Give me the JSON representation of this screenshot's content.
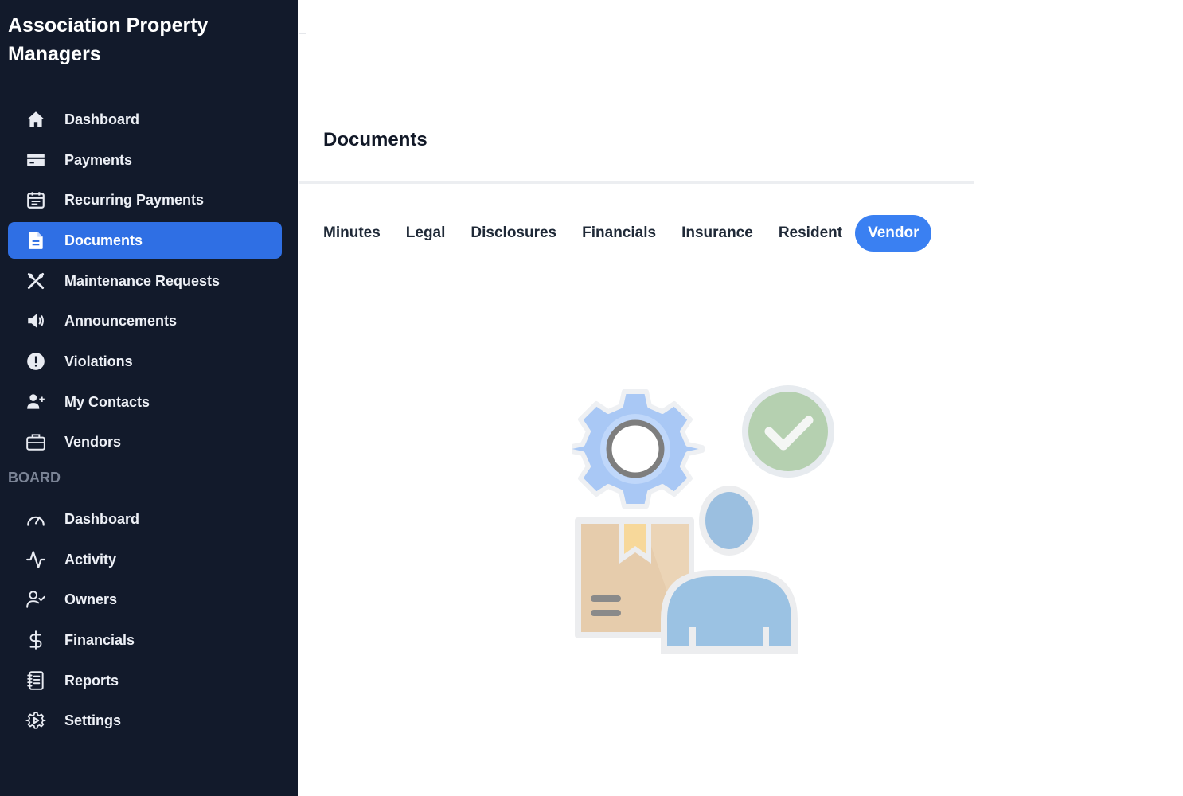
{
  "app": {
    "brand": "Association Property Managers"
  },
  "sidebar": {
    "items": [
      {
        "label": "Dashboard",
        "icon": "home-icon"
      },
      {
        "label": "Payments",
        "icon": "credit-card-icon"
      },
      {
        "label": "Recurring Payments",
        "icon": "calendar-icon"
      },
      {
        "label": "Documents",
        "icon": "document-icon",
        "active": true
      },
      {
        "label": "Maintenance Requests",
        "icon": "tools-icon"
      },
      {
        "label": "Announcements",
        "icon": "megaphone-icon"
      },
      {
        "label": "Violations",
        "icon": "alert-circle-icon"
      },
      {
        "label": "My Contacts",
        "icon": "user-plus-icon"
      },
      {
        "label": "Vendors",
        "icon": "briefcase-icon"
      }
    ],
    "board_section_label": "BOARD",
    "board_items": [
      {
        "label": "Dashboard",
        "icon": "gauge-icon"
      },
      {
        "label": "Activity",
        "icon": "activity-icon"
      },
      {
        "label": "Owners",
        "icon": "user-check-icon"
      },
      {
        "label": "Financials",
        "icon": "dollar-icon"
      },
      {
        "label": "Reports",
        "icon": "notebook-icon"
      },
      {
        "label": "Settings",
        "icon": "settings-icon"
      }
    ]
  },
  "main": {
    "title": "Documents",
    "tabs": [
      {
        "label": "Minutes"
      },
      {
        "label": "Legal"
      },
      {
        "label": "Disclosures"
      },
      {
        "label": "Financials"
      },
      {
        "label": "Insurance"
      },
      {
        "label": "Resident"
      },
      {
        "label": "Vendor",
        "active": true
      }
    ],
    "empty_state_icon": "vendor-illustration-icon"
  },
  "colors": {
    "sidebar_bg": "#121a2b",
    "accent": "#3a80f2",
    "active_nav": "#2f6fe4"
  }
}
